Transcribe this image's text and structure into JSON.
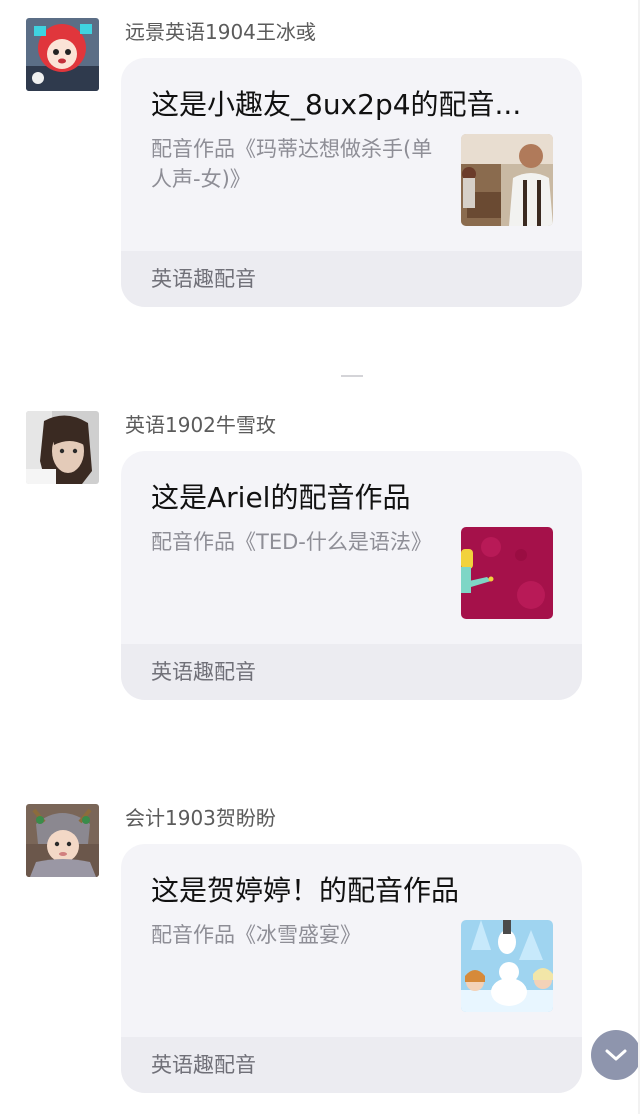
{
  "messages": [
    {
      "sender": "远景英语1904王冰彧",
      "title": "这是小趣友_8ux2p4的配音...",
      "description": "配音作品《玛蒂达想做杀手(单人声-女)》",
      "source": "英语趣配音",
      "avatar_icon": "cartoon-girl-avatar",
      "thumbnail_icon": "movie-still-thumbnail"
    },
    {
      "sender": "英语1902牛雪玫",
      "title": "这是Ariel的配音作品",
      "description": "配音作品《TED-什么是语法》",
      "source": "英语趣配音",
      "avatar_icon": "portrait-avatar",
      "thumbnail_icon": "ted-animation-thumbnail"
    },
    {
      "sender": "会计1903贺盼盼",
      "title": "这是贺婷婷！的配音作品",
      "description": "配音作品《冰雪盛宴》",
      "source": "英语趣配音",
      "avatar_icon": "child-reindeer-hat-avatar",
      "thumbnail_icon": "frozen-olaf-thumbnail"
    }
  ],
  "scroll_button": {
    "icon": "chevron-down-icon",
    "color": "#8e95ad"
  },
  "colors": {
    "card_bg": "#f4f4f8",
    "footer_bg": "#ececf1",
    "title": "#111111",
    "sender": "#5b5b5b",
    "desc": "#8e8e96"
  }
}
